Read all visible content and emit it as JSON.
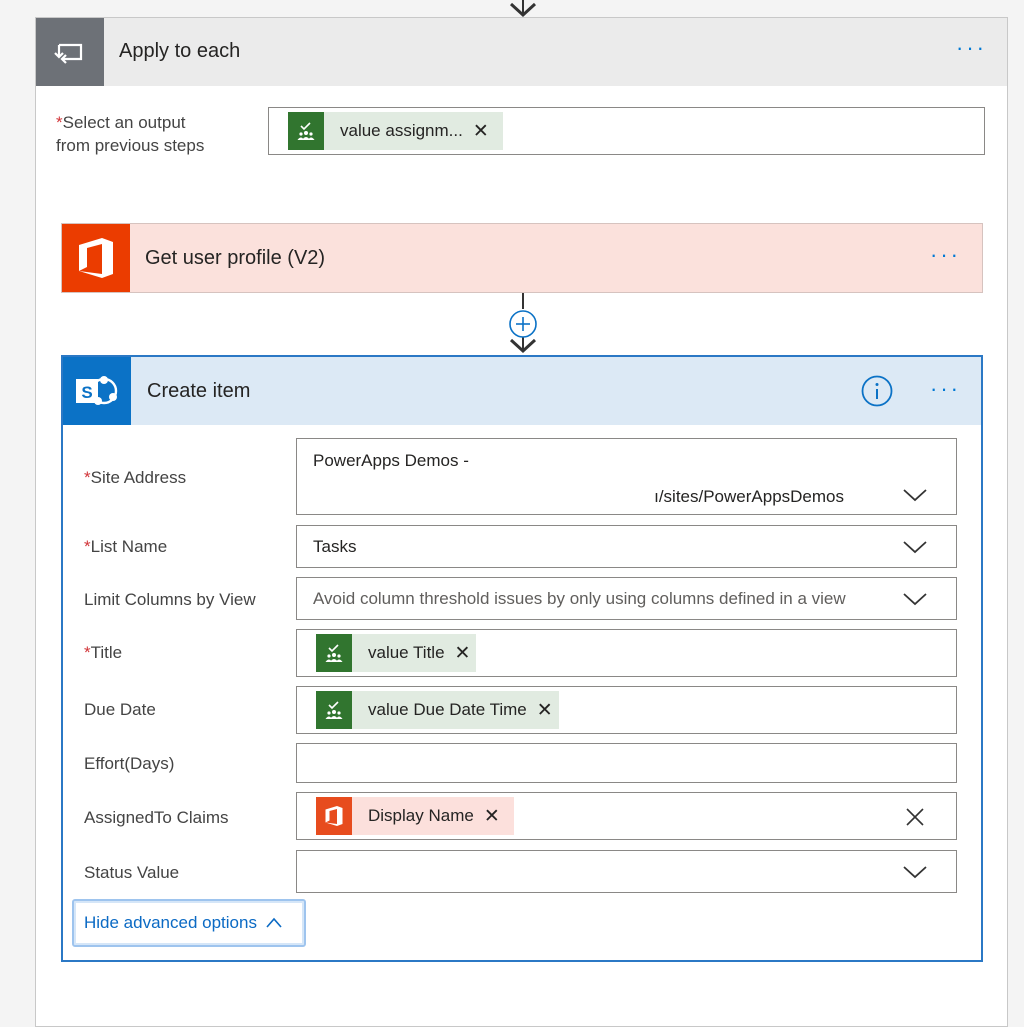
{
  "apply_to_each": {
    "title": "Apply to each",
    "menu_label": "···",
    "select_label_line1": "Select an output",
    "select_label_line2": "from previous steps",
    "required_mark": "*",
    "token": {
      "text": "value assignm...",
      "remove": "✕",
      "icon": "planner-icon"
    }
  },
  "get_user_profile": {
    "title": "Get user profile (V2)",
    "menu_label": "···",
    "icon": "office-icon"
  },
  "create_item": {
    "title": "Create item",
    "menu_label": "···",
    "icon": "sharepoint-icon",
    "fields": {
      "site_address": {
        "label": "Site Address",
        "value_line1": "PowerApps Demos -",
        "value_line2": "ı/sites/PowerAppsDemos"
      },
      "list_name": {
        "label": "List Name",
        "value": "Tasks"
      },
      "limit_columns": {
        "label": "Limit Columns by View",
        "placeholder": "Avoid column threshold issues by only using columns defined in a view"
      },
      "title": {
        "label": "Title",
        "token": "value Title"
      },
      "due_date": {
        "label": "Due Date",
        "token": "value Due Date Time"
      },
      "effort": {
        "label": "Effort(Days)",
        "value": ""
      },
      "assigned_to": {
        "label": "AssignedTo Claims",
        "token": "Display Name"
      },
      "status_value": {
        "label": "Status Value",
        "value": ""
      }
    },
    "advanced_options_label": "Hide advanced options",
    "token_remove": "✕"
  },
  "colors": {
    "accent": "#0078d4",
    "sharepoint": "#0b72c6",
    "office": "#eb3c00",
    "planner": "#31752f",
    "required": "#d13438",
    "apply_icon_bg": "#6d7177"
  }
}
